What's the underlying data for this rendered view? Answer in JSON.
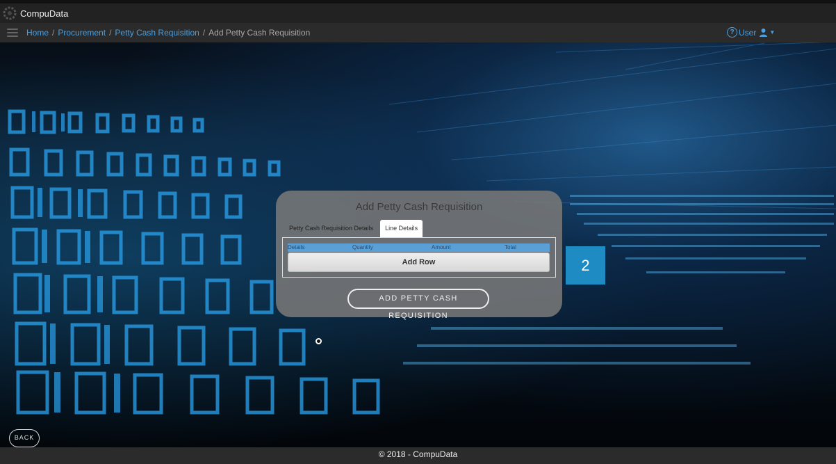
{
  "app": {
    "title": "CompuData"
  },
  "breadcrumb": {
    "items": [
      "Home",
      "Procurement",
      "Petty Cash Requisition"
    ],
    "separator": "/",
    "current": "Add Petty Cash Requisition"
  },
  "user_menu": {
    "label": "User"
  },
  "panel": {
    "title": "Add Petty Cash Requisition",
    "tabs": [
      {
        "label": "Petty Cash Requisition Details",
        "active": false
      },
      {
        "label": "Line Details",
        "active": true
      }
    ],
    "table": {
      "columns": [
        "Details",
        "Quantity",
        "Amount",
        "Total"
      ]
    },
    "add_row_label": "Add Row",
    "submit_label": "ADD PETTY CASH REQUISITION"
  },
  "step_badge": "2",
  "back_label": "BACK",
  "footer": {
    "text": "© 2018 - CompuData"
  },
  "colors": {
    "link": "#4a9fe0",
    "badge": "#1e8bc3",
    "table_header": "#5a9fd6",
    "bar": "#2b2b2b"
  }
}
